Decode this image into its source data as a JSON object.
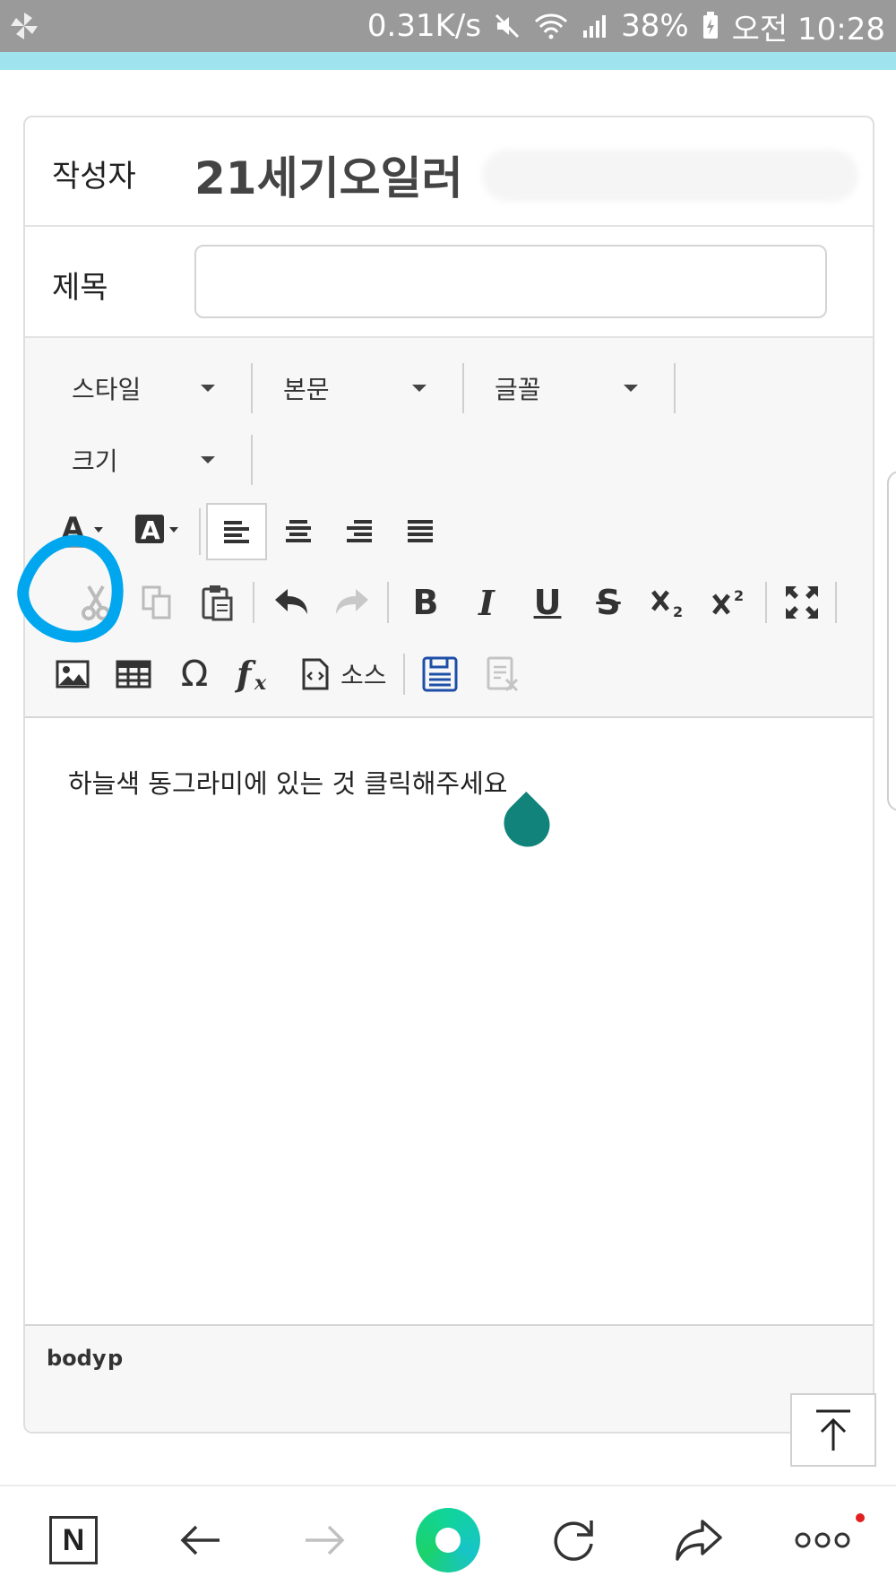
{
  "status_bar": {
    "net_speed": "0.31K/s",
    "battery": "38%",
    "time": "오전 10:28"
  },
  "form": {
    "author_label": "작성자",
    "author_value": "21세기오일러",
    "title_label": "제목",
    "title_value": ""
  },
  "toolbar": {
    "combos": [
      {
        "label": "스타일"
      },
      {
        "label": "본문"
      },
      {
        "label": "글꼴"
      },
      {
        "label": "크기"
      }
    ],
    "source_label": "소스"
  },
  "editor": {
    "content": "하늘색 동그라미에 있는 것 클릭해주세요"
  },
  "pathbar": {
    "items": [
      "body",
      "p"
    ]
  },
  "colors": {
    "highlight_ring": "#00a7ef",
    "accent_strip": "#9ee3ee",
    "drop_marker": "#11837a"
  }
}
